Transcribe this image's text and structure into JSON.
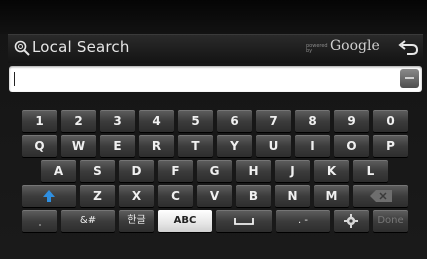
{
  "header": {
    "title": "Local Search",
    "powered_by": "powered by",
    "provider": "Google",
    "icons": {
      "search": "search-icon",
      "back": "back-arrow-icon"
    }
  },
  "search": {
    "value": "",
    "placeholder": ""
  },
  "keyboard": {
    "row1": [
      "1",
      "2",
      "3",
      "4",
      "5",
      "6",
      "7",
      "8",
      "9",
      "0"
    ],
    "row2": [
      "Q",
      "W",
      "E",
      "R",
      "T",
      "Y",
      "U",
      "I",
      "O",
      "P"
    ],
    "row3": [
      "A",
      "S",
      "D",
      "F",
      "G",
      "H",
      "J",
      "K",
      "L"
    ],
    "row4": [
      "Z",
      "X",
      "C",
      "V",
      "B",
      "N",
      "M"
    ],
    "symbols": "&#",
    "korean": "한글",
    "abc": "ABC",
    "punct": ". -",
    "done": "Done",
    "icons": {
      "shift": "shift-arrow-icon",
      "backspace": "backspace-icon",
      "space": "space-icon",
      "settings": "gear-icon"
    }
  },
  "colors": {
    "accent": "#2f8fe0",
    "active_key": "#ffffff"
  }
}
